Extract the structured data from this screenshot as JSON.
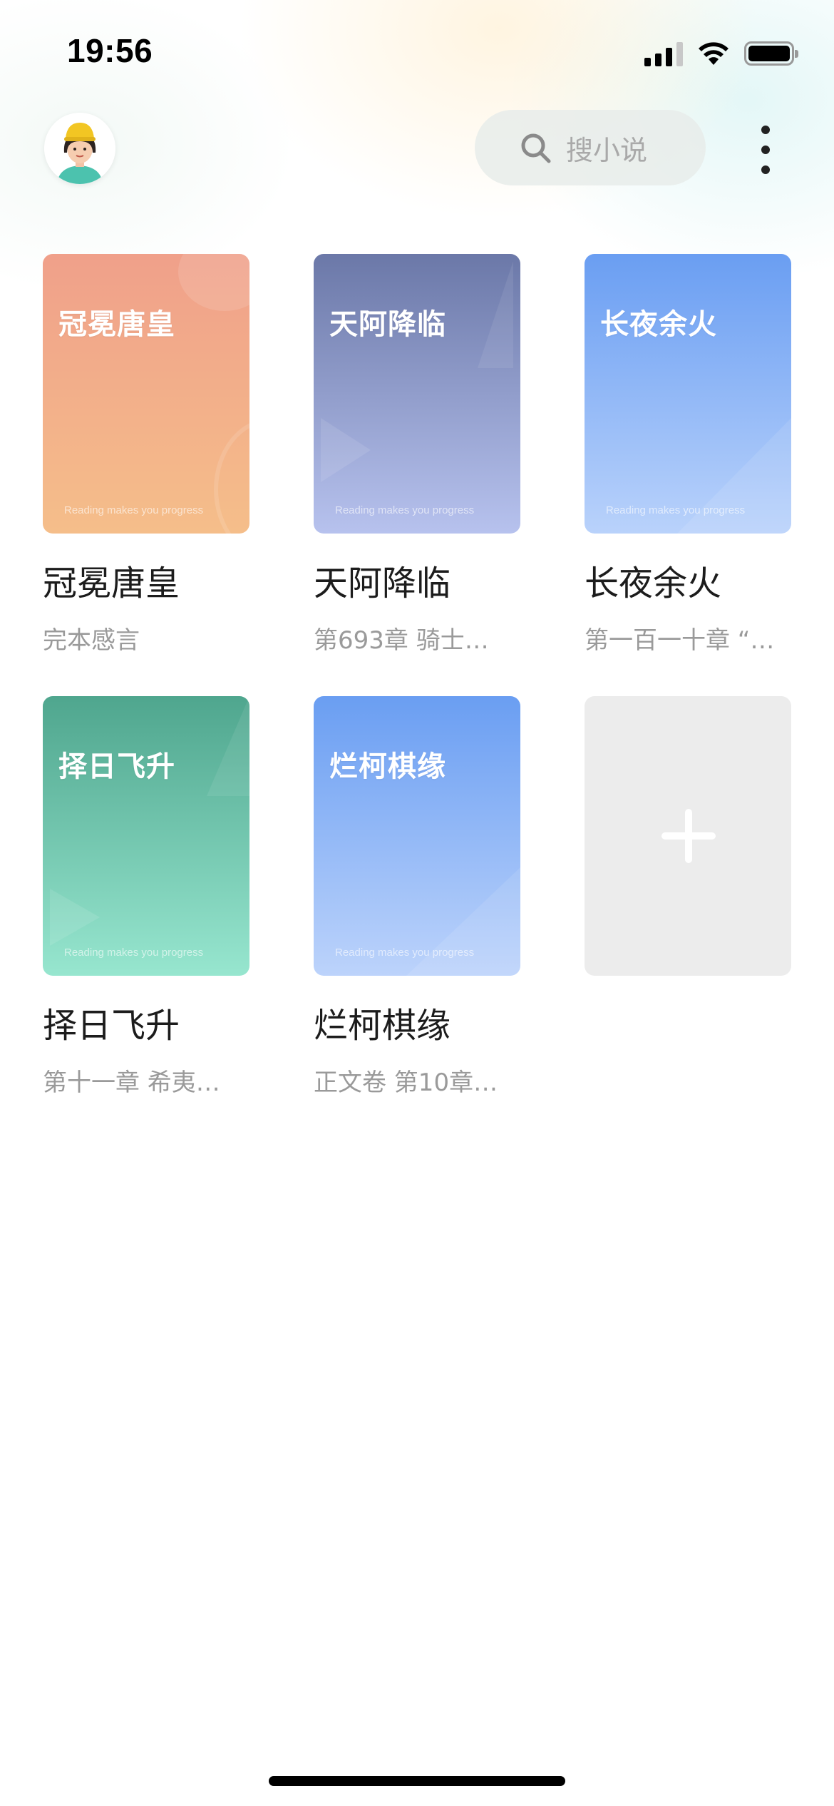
{
  "status_bar": {
    "time": "19:56"
  },
  "header": {
    "search_placeholder": "搜小说",
    "icons": [
      "avatar",
      "search-icon",
      "more-vertical-icon"
    ]
  },
  "bookshelf": {
    "books": [
      {
        "cover_title": "冠冕唐皇",
        "slogan": "Reading makes you progress",
        "title": "冠冕唐皇",
        "progress": "完本感言",
        "cover_colors": [
          "#f0a08a",
          "#f5be8a"
        ]
      },
      {
        "cover_title": "天阿降临",
        "slogan": "Reading makes you progress",
        "title": "天阿降临",
        "progress": "第693章 骑士…",
        "cover_colors": [
          "#6b78a8",
          "#b7c2ee"
        ]
      },
      {
        "cover_title": "长夜余火",
        "slogan": "Reading makes you progress",
        "title": "长夜余火",
        "progress": "第一百一十章 “…",
        "cover_colors": [
          "#6a9ef2",
          "#b9d2fb"
        ]
      },
      {
        "cover_title": "择日飞升",
        "slogan": "Reading makes you progress",
        "title": "择日飞升",
        "progress": "第十一章 希夷…",
        "cover_colors": [
          "#4fa68e",
          "#97e6cf"
        ]
      },
      {
        "cover_title": "烂柯棋缘",
        "slogan": "Reading makes you progress",
        "title": "烂柯棋缘",
        "progress": "正文卷 第10章…",
        "cover_colors": [
          "#6a9ef2",
          "#bcd3fb"
        ]
      }
    ],
    "add_button_icon": "plus-icon"
  }
}
